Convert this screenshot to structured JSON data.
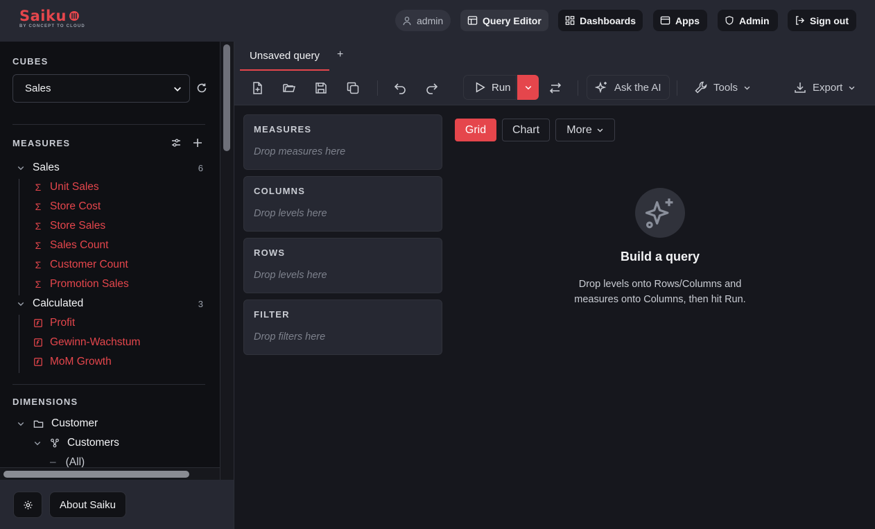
{
  "header": {
    "logo_text": "Saiku",
    "logo_tagline": "BY CONCEPT TO CLOUD",
    "user": "admin",
    "nav": {
      "query_editor": "Query Editor",
      "dashboards": "Dashboards",
      "apps": "Apps",
      "admin": "Admin",
      "sign_out": "Sign out"
    }
  },
  "sidebar": {
    "cubes_title": "CUBES",
    "selected_cube": "Sales",
    "measures_title": "MEASURES",
    "groups": [
      {
        "name": "Sales",
        "count": "6",
        "items": [
          "Unit Sales",
          "Store Cost",
          "Store Sales",
          "Sales Count",
          "Customer Count",
          "Promotion Sales"
        ]
      },
      {
        "name": "Calculated",
        "count": "3",
        "items": [
          "Profit",
          "Gewinn-Wachstum",
          "MoM Growth"
        ]
      }
    ],
    "dimensions_title": "DIMENSIONS",
    "dimensions": {
      "customer": "Customer",
      "customers": "Customers",
      "all": "(All)"
    },
    "footer": {
      "about": "About Saiku"
    }
  },
  "tabs": {
    "active": "Unsaved query",
    "add": "+"
  },
  "toolbar": {
    "run": "Run",
    "ask_ai": "Ask the AI",
    "tools": "Tools",
    "export": "Export"
  },
  "drop_zones": [
    {
      "title": "MEASURES",
      "hint": "Drop measures here"
    },
    {
      "title": "COLUMNS",
      "hint": "Drop levels here"
    },
    {
      "title": "ROWS",
      "hint": "Drop levels here"
    },
    {
      "title": "FILTER",
      "hint": "Drop filters here"
    }
  ],
  "views": {
    "grid": "Grid",
    "chart": "Chart",
    "more": "More"
  },
  "empty_state": {
    "title": "Build a query",
    "line1": "Drop levels onto Rows/Columns and",
    "line2": "measures onto Columns, then hit Run."
  },
  "colors": {
    "accent": "#e5464c",
    "header_bg": "#262832",
    "sidebar_bg": "#0f1014",
    "main_bg": "#16171d"
  }
}
